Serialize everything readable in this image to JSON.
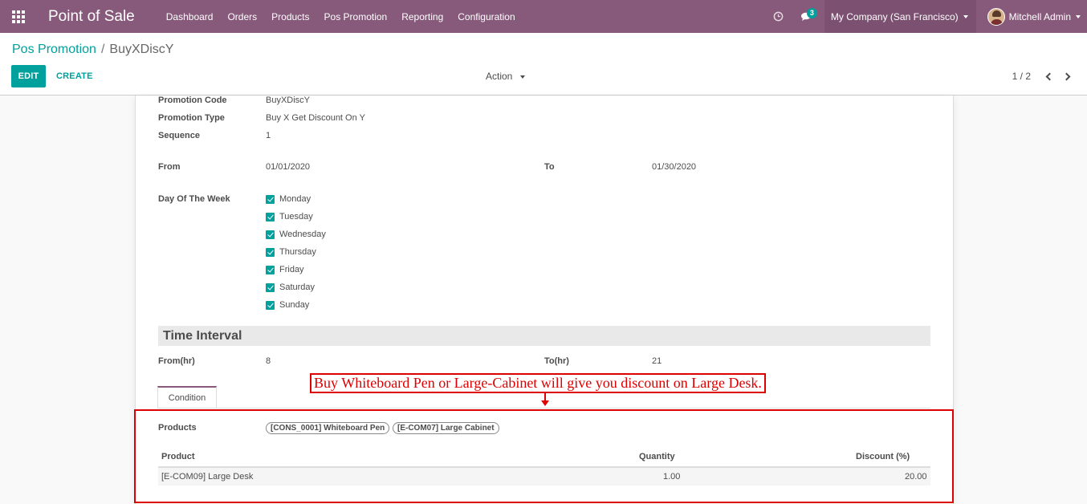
{
  "navbar": {
    "brand": "Point of Sale",
    "menu": [
      "Dashboard",
      "Orders",
      "Products",
      "Pos Promotion",
      "Reporting",
      "Configuration"
    ],
    "messages_count": "3",
    "company": "My Company (San Francisco)",
    "user": "Mitchell Admin",
    "colors": {
      "navbar": "#875a7b",
      "accent": "#00a09d"
    }
  },
  "control_panel": {
    "breadcrumb_parent": "Pos Promotion",
    "breadcrumb_separator": "/",
    "breadcrumb_current": "BuyXDiscY",
    "edit_label": "EDIT",
    "create_label": "CREATE",
    "action_label": "Action",
    "pager": "1 / 2"
  },
  "form": {
    "promotion_code": {
      "label": "Promotion Code",
      "value": "BuyXDiscY"
    },
    "promotion_type": {
      "label": "Promotion Type",
      "value": "Buy X Get Discount On Y"
    },
    "sequence": {
      "label": "Sequence",
      "value": "1"
    },
    "from": {
      "label": "From",
      "value": "01/01/2020"
    },
    "to": {
      "label": "To",
      "value": "01/30/2020"
    },
    "day_of_week": {
      "label": "Day Of The Week",
      "days": [
        "Monday",
        "Tuesday",
        "Wednesday",
        "Thursday",
        "Friday",
        "Saturday",
        "Sunday"
      ]
    },
    "time_interval": {
      "title": "Time Interval",
      "from_hr": {
        "label": "From(hr)",
        "value": "8"
      },
      "to_hr": {
        "label": "To(hr)",
        "value": "21"
      }
    },
    "tab": "Condition",
    "products": {
      "label": "Products",
      "tags": [
        "[CONS_0001] Whiteboard Pen",
        "[E-COM07] Large Cabinet"
      ]
    },
    "table": {
      "headers": [
        "Product",
        "Quantity",
        "Discount (%)"
      ],
      "rows": [
        {
          "product": "[E-COM09] Large Desk",
          "quantity": "1.00",
          "discount": "20.00"
        }
      ]
    }
  },
  "annotation": {
    "text": "Buy Whiteboard Pen or Large-Cabinet will give you discount on Large Desk.",
    "color": "#dd0000"
  }
}
